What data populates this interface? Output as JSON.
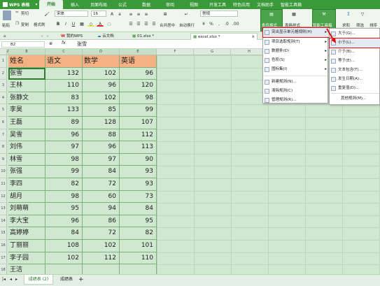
{
  "app": {
    "name": "WPS 表格"
  },
  "menubar": {
    "items": [
      "开始",
      "插入",
      "页面布局",
      "公式",
      "数据",
      "审阅",
      "视图",
      "开发工具",
      "特色应用",
      "文档助手",
      "智能工具箱"
    ]
  },
  "ribbon": {
    "cut": "剪切",
    "copy": "复制",
    "format_painter": "格式刷",
    "paste": "粘贴",
    "font_name": "宋体",
    "font_size": "16",
    "merge_center": "合并居中",
    "auto_wrap": "自动换行",
    "number_format": "常规",
    "conditional_format": "条件格式",
    "table_style": "表格样式",
    "smart_toolbox": "智能工具箱",
    "sum": "求和",
    "filter": "筛选",
    "sort": "排序"
  },
  "tabs": {
    "items": [
      "我的WPS",
      "云文档",
      "01.xlsx *",
      "excel.xlsx *"
    ]
  },
  "formula_bar": {
    "cell_ref": "B2",
    "fx": "fx",
    "value": "张雪"
  },
  "sheet": {
    "col_letters": [
      "A",
      "B",
      "C",
      "D",
      "E",
      "F",
      "G",
      "H",
      "I",
      "J",
      "K",
      "L"
    ],
    "rows": [
      "1",
      "2",
      "3",
      "4",
      "5",
      "6",
      "7",
      "8",
      "9",
      "10",
      "11",
      "12",
      "13",
      "14",
      "15",
      "16",
      "17",
      "18"
    ],
    "headers": [
      "姓名",
      "语文",
      "数学",
      "英语"
    ],
    "data": [
      [
        "张雪",
        "132",
        "102",
        "96"
      ],
      [
        "王林",
        "110",
        "96",
        "120"
      ],
      [
        "张静文",
        "83",
        "102",
        "98"
      ],
      [
        "李昊",
        "133",
        "85",
        "99"
      ],
      [
        "王磊",
        "89",
        "128",
        "107"
      ],
      [
        "吴雪",
        "96",
        "88",
        "112"
      ],
      [
        "刘伟",
        "97",
        "96",
        "113"
      ],
      [
        "林雪",
        "98",
        "97",
        "90"
      ],
      [
        "张强",
        "99",
        "84",
        "93"
      ],
      [
        "李四",
        "82",
        "72",
        "93"
      ],
      [
        "胡月",
        "98",
        "60",
        "73"
      ],
      [
        "刘萌萌",
        "95",
        "94",
        "84"
      ],
      [
        "李大宝",
        "96",
        "86",
        "95"
      ],
      [
        "高婷婷",
        "84",
        "72",
        "82"
      ],
      [
        "丁丽丽",
        "108",
        "102",
        "101"
      ],
      [
        "李子园",
        "102",
        "112",
        "110"
      ],
      [
        "王洁",
        "",
        "",
        ""
      ]
    ]
  },
  "sheet_tabs": [
    "成绩表 (2)",
    "成绩表"
  ],
  "cf_menu": {
    "items": [
      "突出显示单元格规则(H)",
      "项目选取规则(T)",
      "数据条(D)",
      "色阶(S)",
      "图标集(I)",
      "新建规则(N)...",
      "清除规则(C)",
      "管理规则(R)..."
    ]
  },
  "cf_submenu": {
    "items": [
      "大于(G)...",
      "小于(L)...",
      "介于(B)...",
      "等于(E)...",
      "文本包含(T)...",
      "发生日期(A)...",
      "重复值(D)...",
      "其他规则(M)..."
    ]
  }
}
